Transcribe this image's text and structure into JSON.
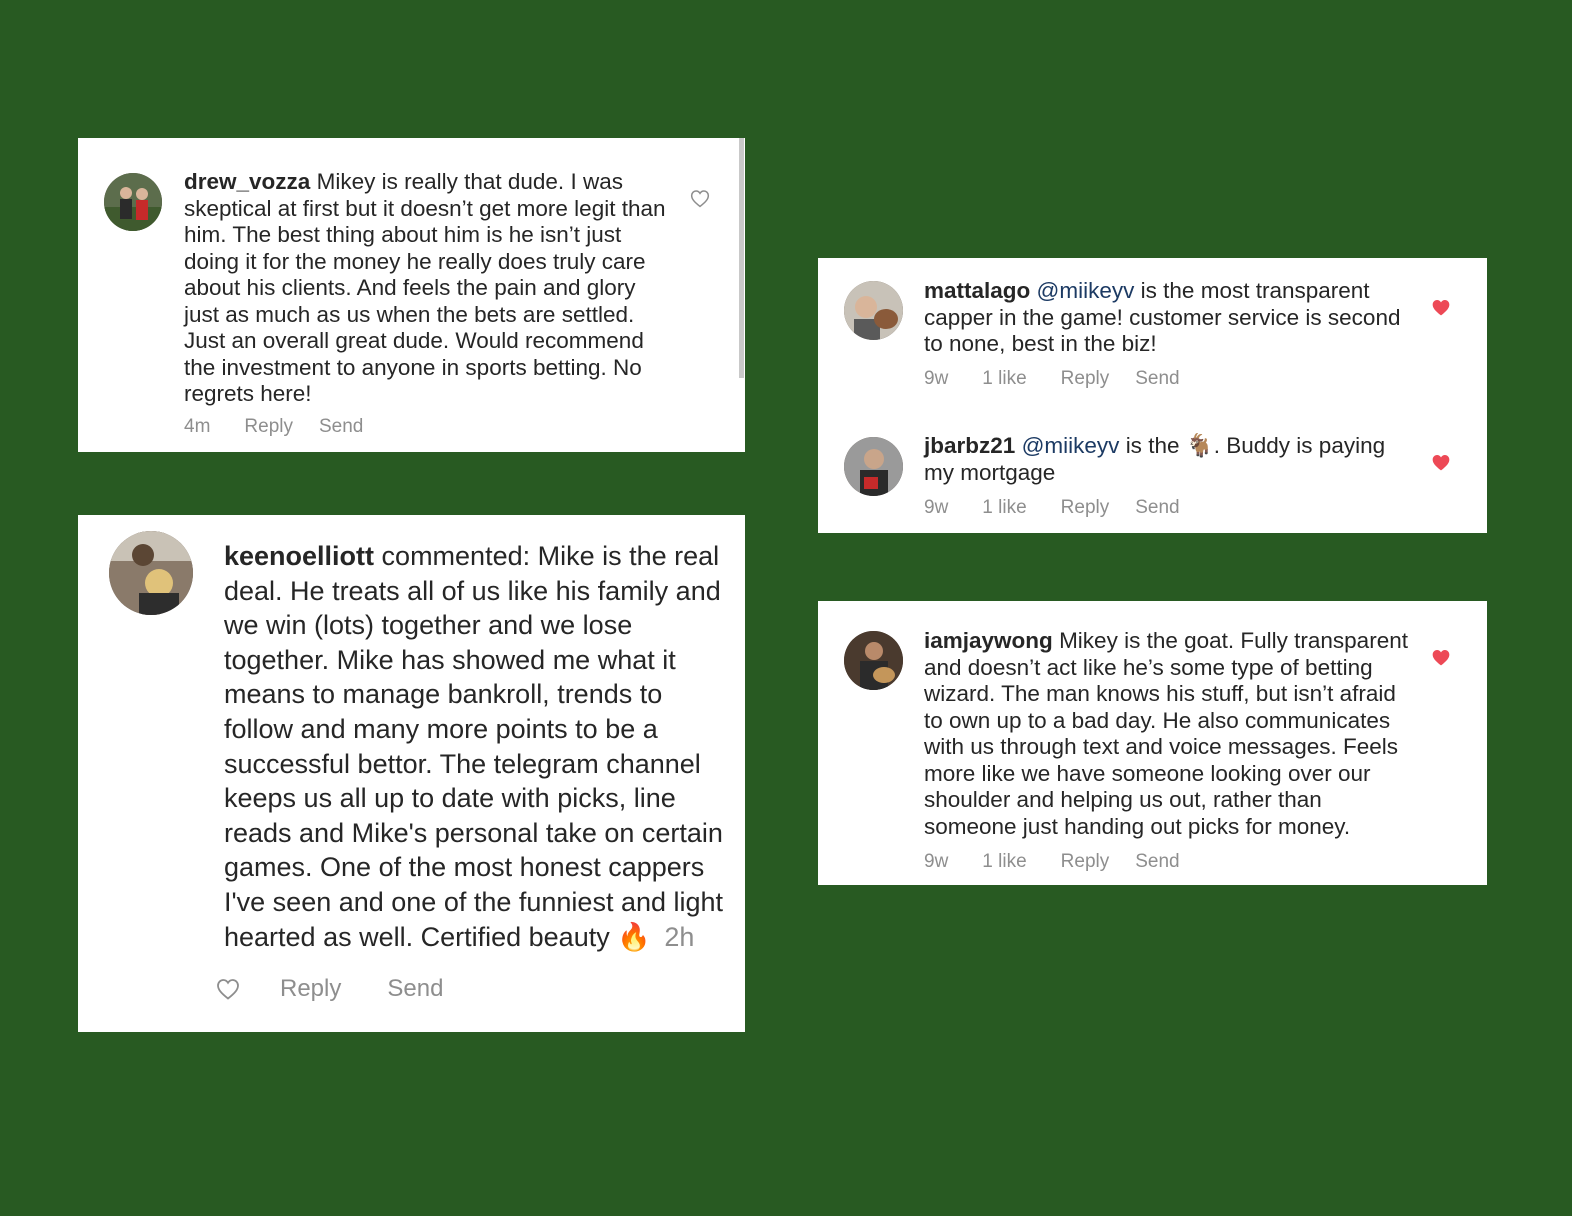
{
  "comments": [
    {
      "username": "drew_vozza",
      "text": "Mikey is really that dude. I was skeptical at first but it doesn’t get more legit than him. The best thing about him is he isn’t just doing it for the money he really does truly care about his clients. And feels the pain and glory just as much as us when the bets are settled. Just an overall great dude. Would recommend the investment to anyone in sports betting. No regrets here!",
      "time": "4m",
      "reply": "Reply",
      "send": "Send",
      "liked": false
    },
    {
      "username": "keenoelliott",
      "text": "commented: Mike is the real deal. He treats all of us like his family and we win (lots) together and we lose together. Mike has showed me what it means to manage bankroll, trends to follow and many more points to be a successful bettor. The telegram channel keeps us all up to date with picks, line reads and Mike's personal take on certain games. One of the most honest cappers I've seen and one of the funniest and light hearted as well. Certified beauty",
      "emoji": "🔥",
      "time": "2h",
      "reply": "Reply",
      "send": "Send",
      "liked": false
    },
    {
      "username": "mattalago",
      "mention": "@miikeyv",
      "text": "is the most transparent capper in the game! customer service is second to none, best in the biz!",
      "time": "9w",
      "likes": "1 like",
      "reply": "Reply",
      "send": "Send",
      "liked": true
    },
    {
      "username": "jbarbz21",
      "mention": "@miikeyv",
      "text_before": "is the",
      "emoji": "🐐",
      "text": ". Buddy is paying my mortgage",
      "time": "9w",
      "likes": "1 like",
      "reply": "Reply",
      "send": "Send",
      "liked": true
    },
    {
      "username": "iamjaywong",
      "text": "Mikey is the goat. Fully transparent and doesn’t act like he’s some type of betting wizard. The man knows his stuff, but isn’t afraid to own up to a bad day. He also communicates with us through text and voice messages. Feels more like we have someone looking over our shoulder and helping us out, rather than someone just handing out picks for money.",
      "time": "9w",
      "likes": "1 like",
      "reply": "Reply",
      "send": "Send",
      "liked": true
    }
  ],
  "colors": {
    "background": "#285a22",
    "liked_heart": "#ed4956",
    "meta_text": "#8e8e8e",
    "mention": "#1c3a63"
  }
}
